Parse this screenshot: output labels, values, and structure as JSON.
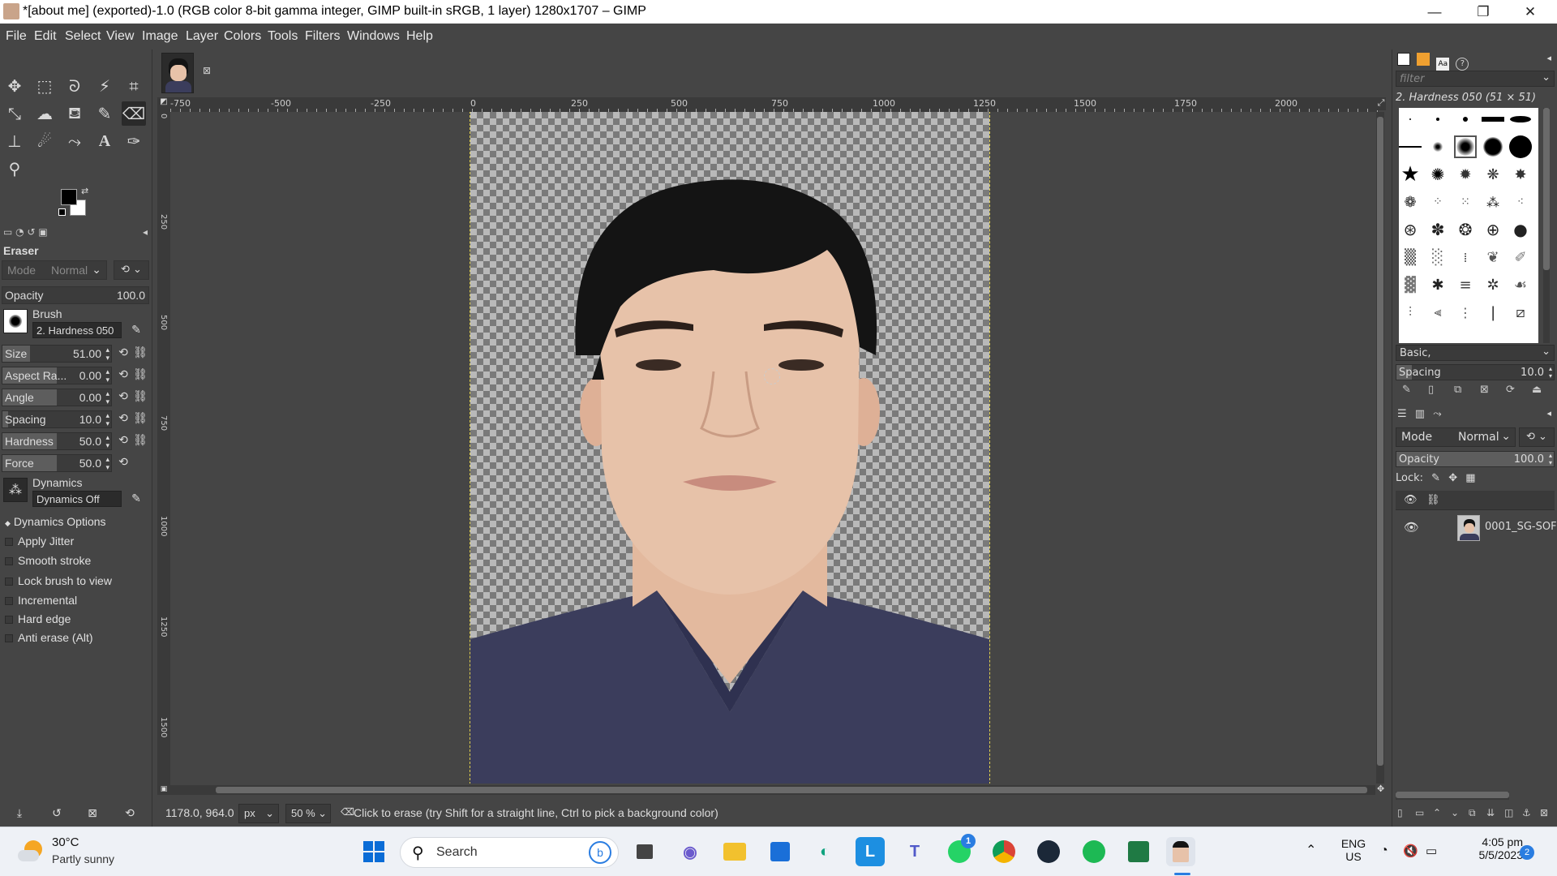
{
  "window": {
    "title": "*[about me] (exported)-1.0 (RGB color 8-bit gamma integer, GIMP built-in sRGB, 1 layer) 1280x1707 – GIMP",
    "minimize": "—",
    "maximize": "❐",
    "close": "✕"
  },
  "menu": [
    "File",
    "Edit",
    "Select",
    "View",
    "Image",
    "Layer",
    "Colors",
    "Tools",
    "Filters",
    "Windows",
    "Help"
  ],
  "toolbox": {
    "tools": [
      "move",
      "rect-select",
      "free-select",
      "fuzzy-select",
      "crop",
      "transform",
      "warp",
      "bucket-fill",
      "paintbrush",
      "eraser",
      "clone",
      "smudge",
      "paths",
      "text",
      "color-picker",
      "zoom"
    ],
    "active_tool": "eraser"
  },
  "tool_options": {
    "title": "Eraser",
    "mode_label": "Mode",
    "mode_value": "Normal",
    "opacity_label": "Opacity",
    "opacity_value": "100.0",
    "brush_label": "Brush",
    "brush_value": "2. Hardness 050",
    "params": [
      {
        "label": "Size",
        "value": "51.00",
        "fill": 0.25
      },
      {
        "label": "Aspect Ra...",
        "value": "0.00",
        "fill": 0.5
      },
      {
        "label": "Angle",
        "value": "0.00",
        "fill": 0.5
      },
      {
        "label": "Spacing",
        "value": "10.0",
        "fill": 0.05
      },
      {
        "label": "Hardness",
        "value": "50.0",
        "fill": 0.5
      },
      {
        "label": "Force",
        "value": "50.0",
        "fill": 0.5
      }
    ],
    "dynamics_label": "Dynamics",
    "dynamics_value": "Dynamics Off",
    "dynamics_options": "Dynamics Options",
    "checkboxes": [
      "Apply Jitter",
      "Smooth stroke",
      "Lock brush to view",
      "Incremental",
      "Hard edge",
      "Anti erase  (Alt)"
    ]
  },
  "rulers": {
    "h_ticks": [
      "-750",
      "-500",
      "-250",
      "0",
      "250",
      "500",
      "750",
      "1000",
      "1250",
      "1500",
      "1750",
      "2000"
    ],
    "v_ticks": [
      "0",
      "250",
      "500",
      "750",
      "1000",
      "1250",
      "1500"
    ]
  },
  "status": {
    "coords": "1178.0, 964.0",
    "unit": "px",
    "zoom": "50 %",
    "message": "Click to erase (try Shift for a straight line, Ctrl to pick a background color)"
  },
  "brushes_panel": {
    "filter_placeholder": "filter",
    "selected_brush": "2. Hardness 050 (51 × 51)",
    "tag_value": "Basic,",
    "spacing_label": "Spacing",
    "spacing_value": "10.0"
  },
  "layers_panel": {
    "mode_label": "Mode",
    "mode_value": "Normal",
    "opacity_label": "Opacity",
    "opacity_value": "100.0",
    "lock_label": "Lock:",
    "layer_name": "0001_SG-SOF"
  },
  "taskbar": {
    "weather_temp": "30°C",
    "weather_desc": "Partly sunny",
    "search_label": "Search",
    "lang_top": "ENG",
    "lang_bottom": "US",
    "time": "4:05 pm",
    "date": "5/5/2023",
    "notif_count": "2",
    "whatsapp_badge": "1",
    "apps": [
      "start",
      "search",
      "task-view",
      "meet",
      "file-explorer",
      "store",
      "edge",
      "l-app",
      "teams",
      "whatsapp",
      "chrome",
      "steam",
      "spotify",
      "excel",
      "gimp"
    ]
  },
  "colors": {
    "dock_bg": "#454545",
    "taskbar_bg": "#eef1f6",
    "shirt": "#3b3d5c",
    "skin": "#e7c2a9",
    "hair": "#141414"
  }
}
